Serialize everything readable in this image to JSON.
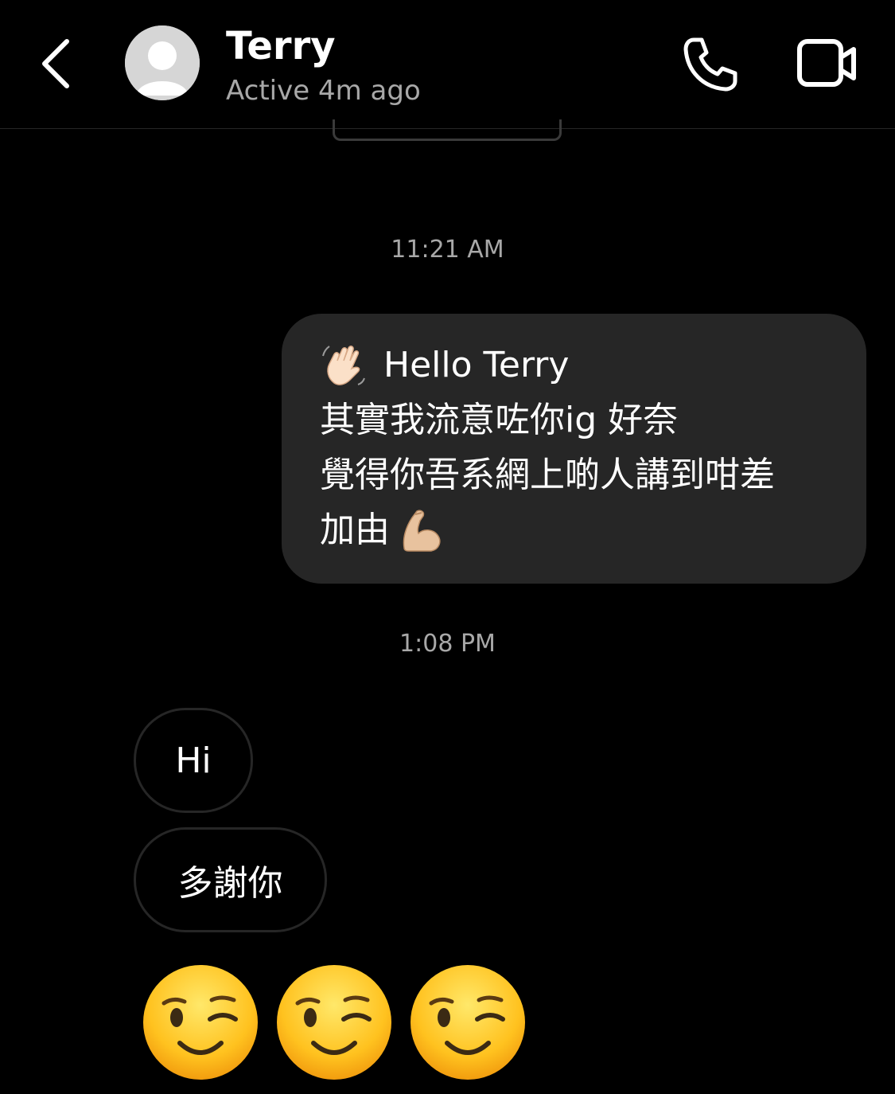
{
  "header": {
    "contact_name": "Terry",
    "status": "Active 4m ago",
    "icons": [
      "chevron-left-icon",
      "avatar-placeholder-icon",
      "phone-icon",
      "video-camera-icon"
    ]
  },
  "conversation": {
    "timestamps": [
      "11:21 AM",
      "1:08 PM"
    ],
    "sent_message": {
      "line1": "Hello Terry",
      "line2": "其實我流意咗你ig 好奈",
      "line3": "覺得你吾系網上啲人講到咁差",
      "line4": "加由",
      "emojis": [
        "waving-hand-emoji",
        "flexed-biceps-emoji"
      ]
    },
    "received_messages": [
      "Hi",
      "多謝你"
    ],
    "emoji_message": [
      "winking-face-emoji",
      "winking-face-emoji",
      "winking-face-emoji"
    ]
  },
  "colors": {
    "background": "#000000",
    "sent_bubble": "#262626",
    "received_border": "#262626",
    "secondary_text": "#a8a8a8"
  }
}
